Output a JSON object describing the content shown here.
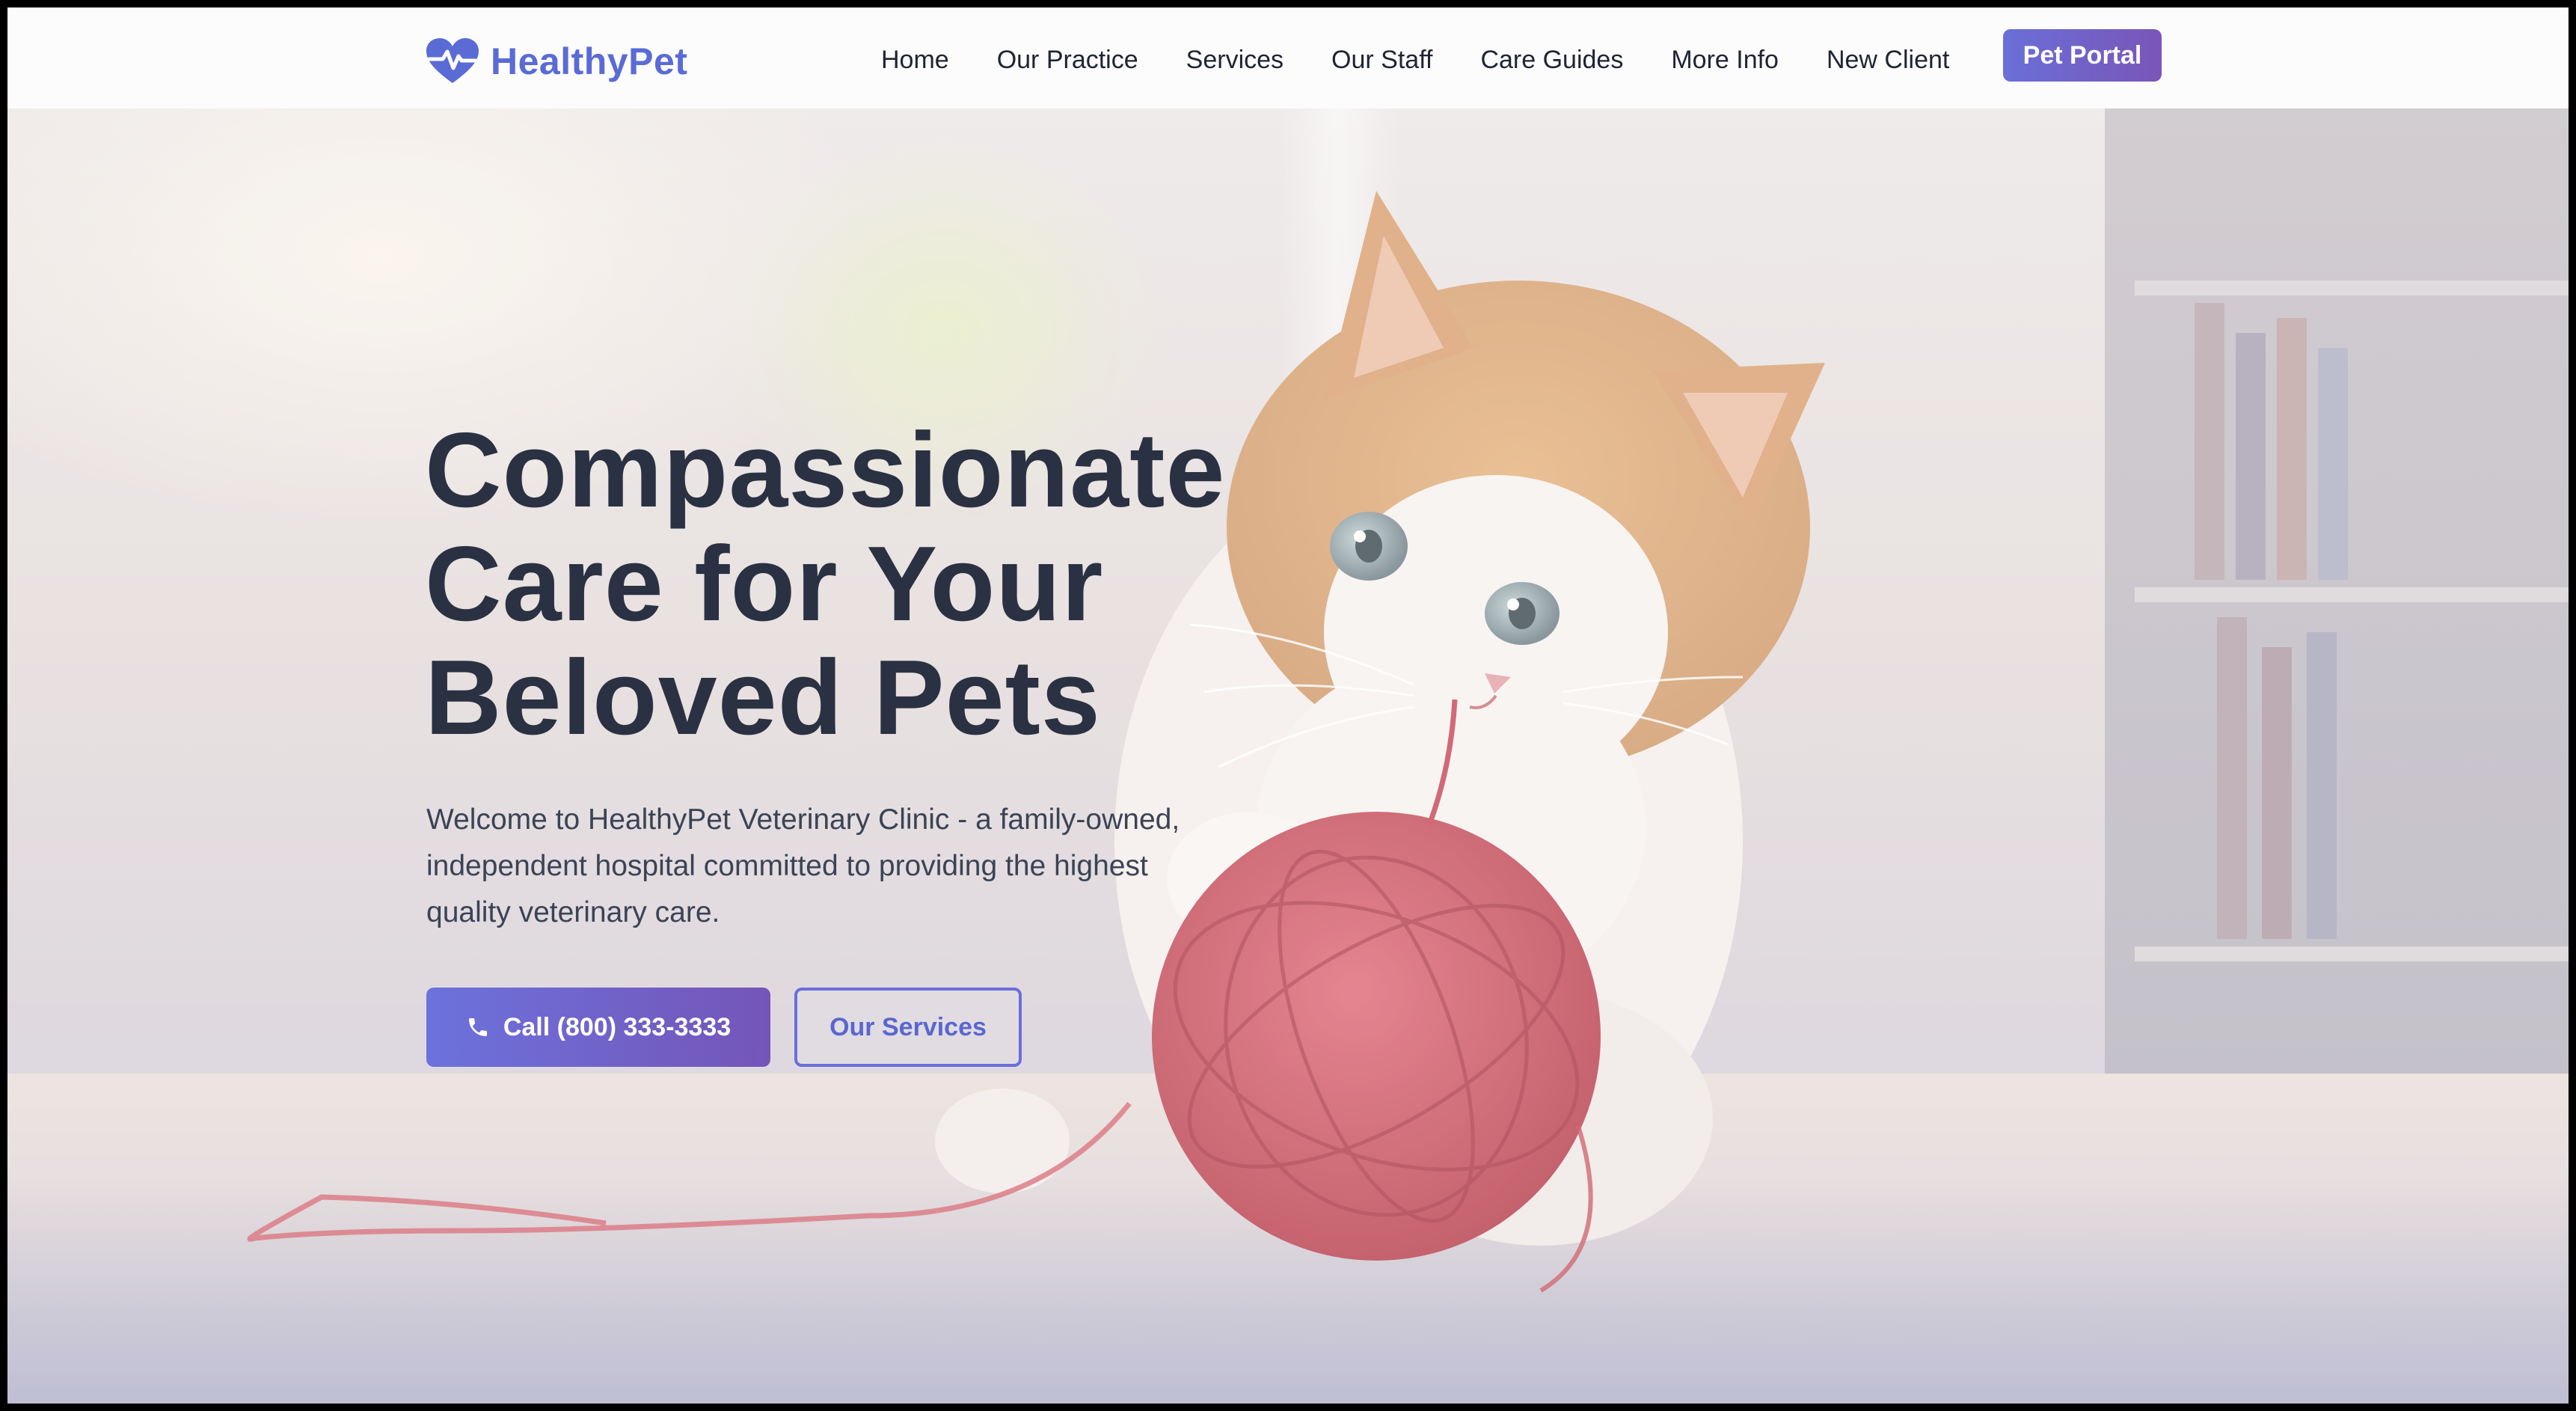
{
  "brand": {
    "name": "HealthyPet",
    "logo_icon": "heart-pulse-icon",
    "color": "#5a6bd6"
  },
  "nav": {
    "items": [
      {
        "label": "Home"
      },
      {
        "label": "Our Practice"
      },
      {
        "label": "Services"
      },
      {
        "label": "Our Staff"
      },
      {
        "label": "Care Guides"
      },
      {
        "label": "More Info"
      },
      {
        "label": "New Client"
      }
    ],
    "portal_label": "Pet Portal"
  },
  "hero": {
    "title_lines": [
      "Compassionate",
      "Care for Your",
      "Beloved Pets"
    ],
    "subtitle_lines": [
      "Welcome to HealthyPet Veterinary Clinic - a family-owned,",
      "independent hospital committed to providing the highest",
      "quality veterinary care."
    ],
    "call_button": {
      "label": "Call (800) 333-3333",
      "icon": "phone-icon"
    },
    "services_button": {
      "label": "Our Services"
    },
    "background_image": "kitten-with-red-yarn-ball"
  },
  "colors": {
    "accent_start": "#6a6fd8",
    "accent_end": "#7a55b8",
    "heading": "#2a3142"
  }
}
